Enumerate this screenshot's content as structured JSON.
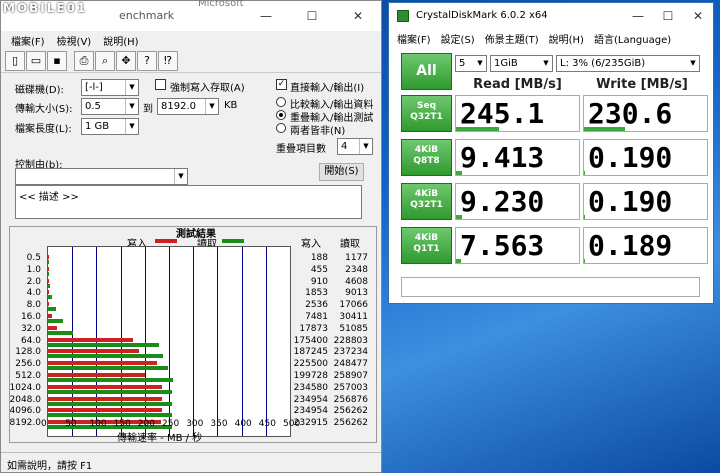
{
  "watermark": "MOBILE01",
  "bg_text": "Microsoft",
  "atto": {
    "title_fragment": "enchmark",
    "menu": [
      "檔案(F)",
      "檢視(V)",
      "說明(H)"
    ],
    "drive_label": "磁碟機(D):",
    "drive_value": "[-l-]",
    "transfer_label": "傳輸大小(S):",
    "transfer_from": "0.5",
    "to_label": "到",
    "transfer_to": "8192.0",
    "kb_label": "KB",
    "length_label": "檔案長度(L):",
    "length_value": "1 GB",
    "force_write_label": "強制寫入存取(A)",
    "direct_io_label": "直接輸入/輸出(I)",
    "radio_compare": "比較輸入/輸出資料",
    "radio_overlap": "重疊輸入/輸出測試",
    "radio_neither": "兩者皆非(N)",
    "queue_label": "重疊項目數",
    "queue_value": "4",
    "control_label": "控制由(b):",
    "start_button": "開始(S)",
    "description": "<< 描述 >>",
    "results_title": "測試結果",
    "legend_write": "寫入",
    "legend_read": "讀取",
    "col_write": "寫入",
    "col_read": "讀取",
    "xaxis_label": "傳輸速率 - MB / 秒",
    "xticks": [
      "0",
      "50",
      "100",
      "150",
      "200",
      "250",
      "300",
      "350",
      "400",
      "450",
      "500"
    ],
    "status": "如需說明，請按 F1",
    "colors": {
      "write": "#cc2222",
      "read": "#1a8c1a"
    }
  },
  "chart_data": {
    "type": "bar",
    "categories": [
      "0.5",
      "1.0",
      "2.0",
      "4.0",
      "8.0",
      "16.0",
      "32.0",
      "64.0",
      "128.0",
      "256.0",
      "512.0",
      "1024.0",
      "2048.0",
      "4096.0",
      "8192.0"
    ],
    "series": [
      {
        "name": "寫入",
        "values": [
          188,
          455,
          910,
          1853,
          2536,
          7481,
          17873,
          175400,
          187245,
          225500,
          199728,
          234580,
          234954,
          234954,
          232915
        ]
      },
      {
        "name": "讀取",
        "values": [
          1177,
          2348,
          4608,
          9013,
          17066,
          30411,
          51085,
          228803,
          237234,
          248477,
          258907,
          257003,
          256876,
          256262,
          256262
        ]
      }
    ],
    "xlabel": "傳輸速率 - MB / 秒",
    "xlim": [
      0,
      500
    ]
  },
  "cdm": {
    "title": "CrystalDiskMark 6.0.2 x64",
    "menu": [
      "檔案(F)",
      "設定(S)",
      "佈景主題(T)",
      "說明(H)",
      "語言(Language)"
    ],
    "all_label": "All",
    "runs": "5",
    "size": "1GiB",
    "drive": "L: 3% (6/235GiB)",
    "read_header": "Read [MB/s]",
    "write_header": "Write [MB/s]",
    "tests": [
      {
        "l1": "Seq",
        "l2": "Q32T1",
        "read": "245.1",
        "write": "230.6",
        "read_fill": 0.35,
        "write_fill": 0.33
      },
      {
        "l1": "4KiB",
        "l2": "Q8T8",
        "read": "9.413",
        "write": "0.190",
        "read_fill": 0.05,
        "write_fill": 0.01
      },
      {
        "l1": "4KiB",
        "l2": "Q32T1",
        "read": "9.230",
        "write": "0.190",
        "read_fill": 0.05,
        "write_fill": 0.01
      },
      {
        "l1": "4KiB",
        "l2": "Q1T1",
        "read": "7.563",
        "write": "0.189",
        "read_fill": 0.04,
        "write_fill": 0.01
      }
    ]
  }
}
